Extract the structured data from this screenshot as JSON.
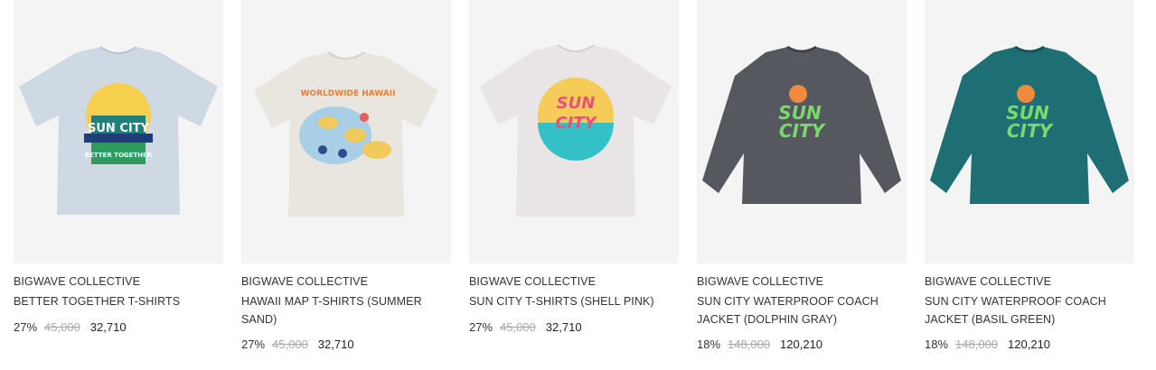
{
  "products": [
    {
      "brand": "BIGWAVE COLLECTIVE",
      "name": "BETTER TOGETHER T-SHIRTS",
      "discount": "27%",
      "original_price": "45,000",
      "sale_price": "32,710",
      "image": {
        "type": "tshirt",
        "garment_color": "#cfd9e3",
        "print": "Sun City Better Together badge",
        "print_texts": [
          "SUN CITY",
          "BETTER TOGETHER"
        ]
      }
    },
    {
      "brand": "BIGWAVE COLLECTIVE",
      "name": "HAWAII MAP T-SHIRTS (SUMMER SAND)",
      "discount": "27%",
      "original_price": "45,000",
      "sale_price": "32,710",
      "image": {
        "type": "tshirt",
        "garment_color": "#e9e6df",
        "print": "Worldwide Hawaii map",
        "print_texts": [
          "WORLDWIDE HAWAII"
        ]
      }
    },
    {
      "brand": "BIGWAVE COLLECTIVE",
      "name": "SUN CITY T-SHIRTS (SHELL PINK)",
      "discount": "27%",
      "original_price": "45,000",
      "sale_price": "32,710",
      "image": {
        "type": "tshirt",
        "garment_color": "#e9e5e7",
        "print": "Sun City circle",
        "print_texts": [
          "SUN",
          "CITY"
        ]
      }
    },
    {
      "brand": "BIGWAVE COLLECTIVE",
      "name": "SUN CITY WATERPROOF COACH JACKET (DOLPHIN GRAY)",
      "discount": "18%",
      "original_price": "148,000",
      "sale_price": "120,210",
      "image": {
        "type": "jacket",
        "garment_color": "#55585e",
        "print": "Sun City script with sun",
        "print_texts": [
          "SUN",
          "CITY"
        ]
      }
    },
    {
      "brand": "BIGWAVE COLLECTIVE",
      "name": "SUN CITY WATERPROOF COACH JACKET (BASIL GREEN)",
      "discount": "18%",
      "original_price": "148,000",
      "sale_price": "120,210",
      "image": {
        "type": "jacket",
        "garment_color": "#1e6f74",
        "print": "Sun City script with sun",
        "print_texts": [
          "SUN",
          "CITY"
        ]
      }
    }
  ]
}
